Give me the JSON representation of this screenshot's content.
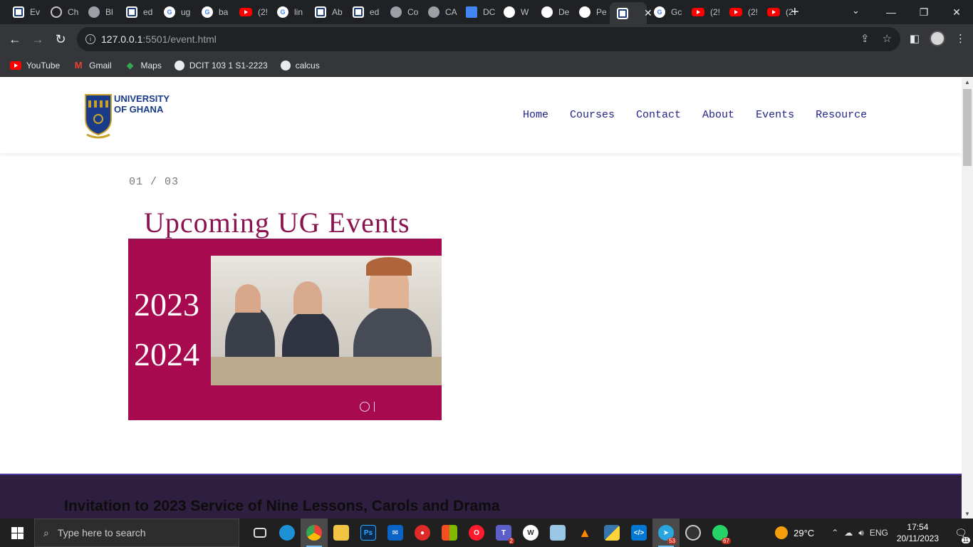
{
  "browser": {
    "tabs": [
      {
        "label": "Ev",
        "icon": "doc-icon",
        "cls": "doc"
      },
      {
        "label": "Ch",
        "icon": "chatgpt-icon",
        "cls": "gpt"
      },
      {
        "label": "Bl",
        "icon": "globe-icon",
        "cls": "globe"
      },
      {
        "label": "ed",
        "icon": "doc-icon",
        "cls": "doc"
      },
      {
        "label": "ug",
        "icon": "google-icon",
        "cls": "g"
      },
      {
        "label": "ba",
        "icon": "google-icon",
        "cls": "g"
      },
      {
        "label": "(2!",
        "icon": "youtube-icon",
        "cls": "yt"
      },
      {
        "label": "lin",
        "icon": "google-icon",
        "cls": "g"
      },
      {
        "label": "Ab",
        "icon": "doc-icon",
        "cls": "doc"
      },
      {
        "label": "ed",
        "icon": "doc-icon",
        "cls": "doc"
      },
      {
        "label": "Co",
        "icon": "globe-icon",
        "cls": "globe"
      },
      {
        "label": "CA",
        "icon": "globe-icon",
        "cls": "globe"
      },
      {
        "label": "DC",
        "icon": "google-docs-icon",
        "cls": "gdoc"
      },
      {
        "label": "W",
        "icon": "github-icon",
        "cls": "gh"
      },
      {
        "label": "De",
        "icon": "github-icon",
        "cls": "gh"
      },
      {
        "label": "Pe",
        "icon": "github-icon",
        "cls": "gh"
      },
      {
        "label": "",
        "icon": "doc-icon",
        "cls": "doc",
        "active": true
      },
      {
        "label": "Gc",
        "icon": "google-icon",
        "cls": "g"
      },
      {
        "label": "(2!",
        "icon": "youtube-icon",
        "cls": "yt"
      },
      {
        "label": "(2!",
        "icon": "youtube-icon",
        "cls": "yt"
      },
      {
        "label": "(2",
        "icon": "youtube-icon",
        "cls": "yt"
      }
    ],
    "url_host": "127.0.0.1",
    "url_path": ":5501/event.html",
    "bookmarks": [
      {
        "label": "YouTube",
        "icon": "youtube-icon",
        "cls": "yt"
      },
      {
        "label": "Gmail",
        "icon": "gmail-icon",
        "cls": "gm",
        "glyph": "M"
      },
      {
        "label": "Maps",
        "icon": "maps-icon",
        "cls": "maps",
        "glyph": "◆"
      },
      {
        "label": "DCIT 103 1 S1-2223",
        "icon": "globe-icon",
        "cls": "globe",
        "glyph": ""
      },
      {
        "label": "calcus",
        "icon": "globe-icon",
        "cls": "globe",
        "glyph": ""
      }
    ]
  },
  "site": {
    "logo_line1": "UNIVERSITY",
    "logo_line2": "OF GHANA",
    "nav": [
      "Home",
      "Courses",
      "Contact",
      "About",
      "Events",
      "Resource"
    ],
    "counter": "01 / 03",
    "event_title": "Upcoming UG Events",
    "year1": "2023",
    "year2": "2024",
    "section_heading": "Invitation to 2023 Service of Nine Lessons, Carols and Drama"
  },
  "taskbar": {
    "search_placeholder": "Type here to search",
    "weather": "29°C",
    "lang": "ENG",
    "time": "17:54",
    "date": "20/11/2023",
    "notifications": "11",
    "badges": {
      "teams": "2",
      "telegram": "53",
      "whatsapp": "67"
    }
  }
}
